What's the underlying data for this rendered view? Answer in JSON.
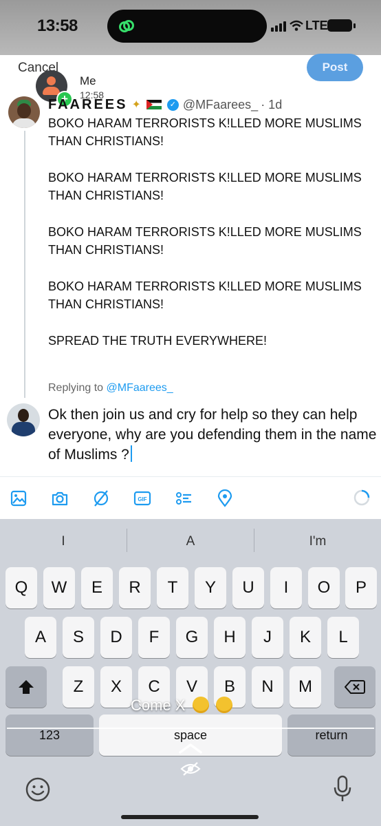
{
  "status_bar": {
    "time": "13:58",
    "network": "LTE"
  },
  "header": {
    "cancel_label": "Cancel",
    "post_label": "Post"
  },
  "story": {
    "user": "Me",
    "time": "12:58",
    "caption": "Come X"
  },
  "tweet": {
    "name": "FAAREES",
    "handle": "@MFaarees_",
    "age": "· 1d",
    "lines": [
      "BOKO HARAM TERRORISTS K!LLED MORE MUSLIMS THAN CHRISTIANS!",
      "BOKO HARAM TERRORISTS K!LLED MORE MUSLIMS THAN CHRISTIANS!",
      "BOKO HARAM TERRORISTS K!LLED MORE MUSLIMS THAN CHRISTIANS!",
      "BOKO HARAM TERRORISTS K!LLED MORE MUSLIMS THAN CHRISTIANS!",
      "SPREAD THE TRUTH EVERYWHERE!"
    ]
  },
  "reply": {
    "replying_to_label": "Replying to",
    "replying_to_handle": "@MFaarees_",
    "text": "Ok then join us and cry for help so they can help everyone, why are you defending them in the name of Muslims ?"
  },
  "compose_tools": [
    "image-icon",
    "camera-icon",
    "no-gif-icon",
    "gif-icon",
    "poll-icon",
    "location-icon"
  ],
  "keyboard": {
    "suggestions": [
      "I",
      "A",
      "I'm"
    ],
    "row1": [
      "Q",
      "W",
      "E",
      "R",
      "T",
      "Y",
      "U",
      "I",
      "O",
      "P"
    ],
    "row2": [
      "A",
      "S",
      "D",
      "F",
      "G",
      "H",
      "J",
      "K",
      "L"
    ],
    "row3": [
      "Z",
      "X",
      "C",
      "V",
      "B",
      "N",
      "M"
    ],
    "numbers_label": "123",
    "space_label": "space",
    "return_label": "return"
  },
  "colors": {
    "accent": "#1d9bf0",
    "post_button": "#5b9fe0",
    "keyboard_bg": "#cfd3da"
  }
}
